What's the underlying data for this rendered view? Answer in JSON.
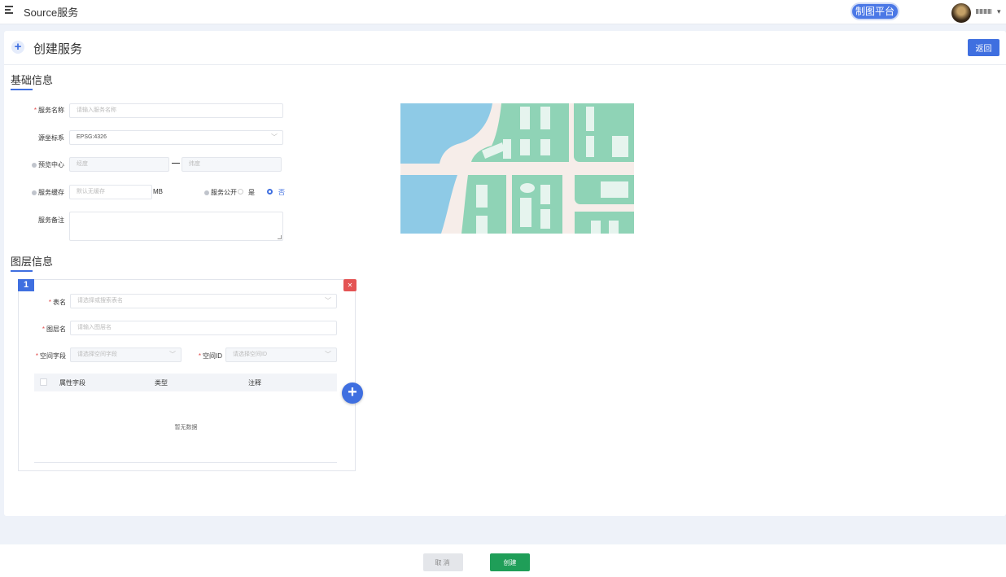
{
  "header": {
    "app_title": "Source服务",
    "platform_button": "制图平台",
    "user_caret": "▾",
    "icons": {
      "menu": "menu-icon",
      "avatar": "user-avatar"
    }
  },
  "page": {
    "title": "创建服务",
    "back_label": "返回",
    "plus_glyph": "+"
  },
  "basic_info": {
    "section_title": "基础信息",
    "service_name": {
      "label": "服务名称",
      "required_mark": "*",
      "placeholder": "请输入服务名称"
    },
    "coord_system": {
      "label": "源坐标系",
      "value": "EPSG:4326",
      "caret": "﹀"
    },
    "preview_center": {
      "label": "预览中心",
      "lon_placeholder": "经度",
      "separator": "—",
      "lat_placeholder": "纬度"
    },
    "service_cache": {
      "label": "服务缓存",
      "placeholder": "默认无缓存",
      "unit": "MB"
    },
    "service_public": {
      "label": "服务公开",
      "options": [
        "是",
        "否"
      ],
      "selected": "否"
    },
    "remark": {
      "label": "服务备注"
    }
  },
  "layer_info": {
    "section_title": "图层信息",
    "layers": [
      {
        "index": "1",
        "delete_glyph": "✕",
        "table_name": {
          "label": "表名",
          "required_mark": "*",
          "placeholder": "请选择或搜索表名",
          "caret": "﹀"
        },
        "layer_name": {
          "label": "图层名",
          "required_mark": "*",
          "placeholder": "请输入图层名"
        },
        "spatial_field": {
          "label": "空间字段",
          "required_mark": "*",
          "placeholder": "请选择空间字段",
          "caret": "﹀"
        },
        "spatial_id": {
          "label": "空间ID",
          "required_mark": "*",
          "placeholder": "请选择空间ID",
          "caret": "﹀"
        },
        "table": {
          "columns": [
            "属性字段",
            "类型",
            "注释"
          ],
          "rows": [],
          "empty_text": "暂无数据"
        }
      }
    ],
    "add_glyph": "+"
  },
  "footer": {
    "cancel_label": "取消",
    "create_label": "创建"
  },
  "colors": {
    "primary": "#3f6fe0",
    "create": "#1f9e58",
    "danger": "#e45454",
    "map_water": "#8ecae6",
    "map_block": "#8fd3b6",
    "map_road": "#f6ede9"
  }
}
